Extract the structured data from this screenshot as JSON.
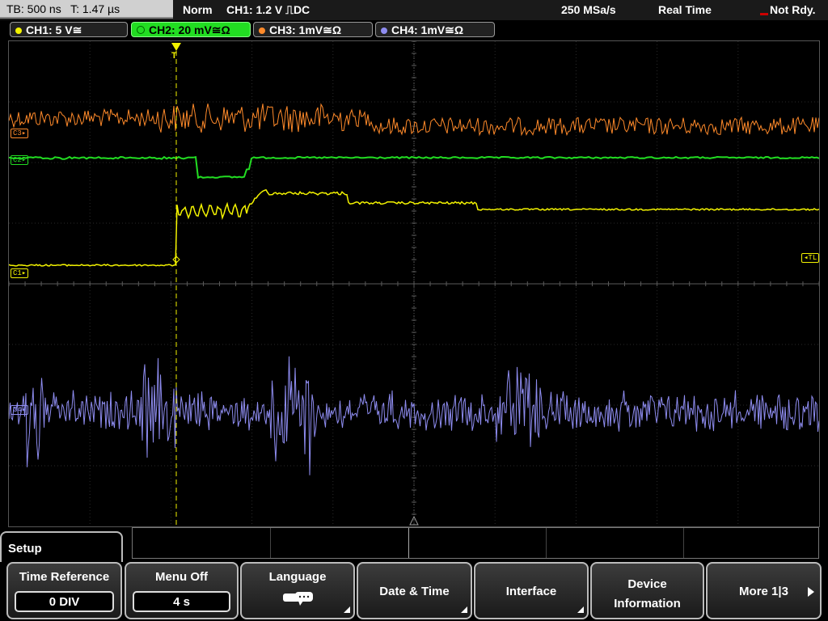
{
  "top_bar": {
    "timebase": "TB: 500 ns   T: 1.47 µs",
    "trigger_mode": "Norm",
    "trigger_info": "CH1: 1.2 V ⎍DC",
    "sample_rate": "250 MSa/s",
    "acq_mode": "Real Time",
    "status": "Not Rdy."
  },
  "channels": [
    {
      "label": "CH1: 5 V≅",
      "color": "#f2f200",
      "marker": "C1"
    },
    {
      "label": "CH2: 20 mV≅Ω",
      "color": "#22dd22",
      "marker": "C2"
    },
    {
      "label": "CH3: 1mV≅Ω",
      "color": "#ff8a2a",
      "marker": "C3"
    },
    {
      "label": "CH4: 1mV≅Ω",
      "color": "#8e8cf0",
      "marker": "C4"
    }
  ],
  "trigger": {
    "level_marker": "TL",
    "position_marker": "T"
  },
  "menu": {
    "title": "Setup",
    "keys": [
      {
        "title": "Time Reference",
        "value": "0 DIV"
      },
      {
        "title": "Menu Off",
        "value": "4 s"
      },
      {
        "title": "Language",
        "icon": "speech-bubble-icon"
      },
      {
        "title": "Date & Time"
      },
      {
        "title": "Interface"
      },
      {
        "title": "Device",
        "title2": "Information"
      },
      {
        "title": "More 1|3",
        "icon": "play-arrow-icon"
      }
    ]
  }
}
